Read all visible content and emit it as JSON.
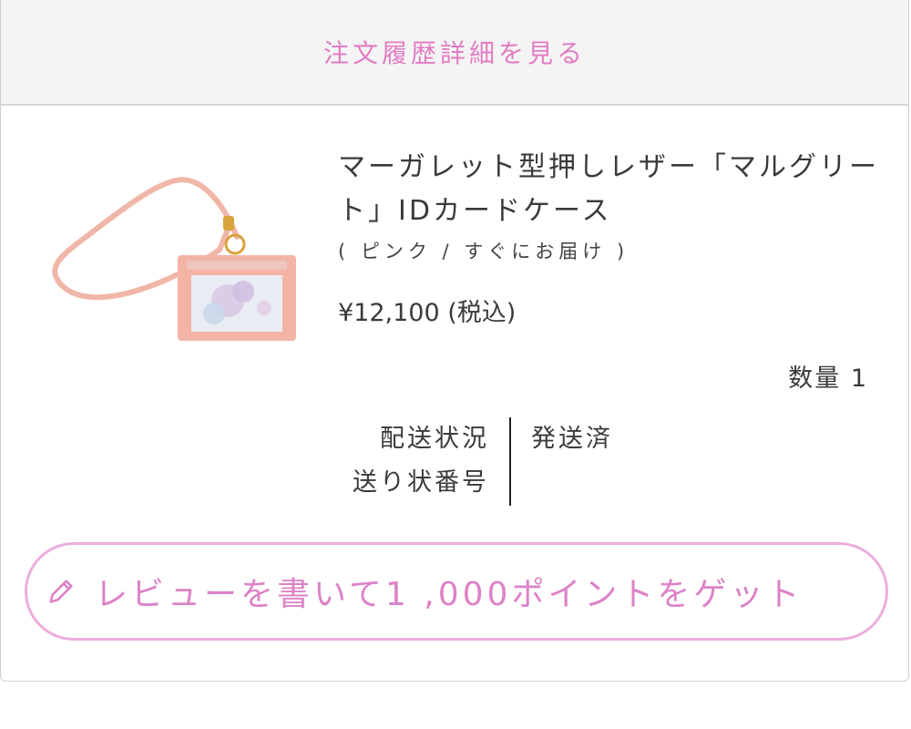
{
  "header": {
    "order_detail_link": "注文履歴詳細を見る"
  },
  "product": {
    "title": "マーガレット型押しレザー「マルグリート」IDカードケース",
    "variant": "( ピンク / すぐにお届け )",
    "price": "¥12,100 (税込)",
    "quantity": "数量 1",
    "image_icon": "id-card-case-image"
  },
  "shipping": {
    "status_label": "配送状況",
    "tracking_label": "送り状番号",
    "status_value": "発送済",
    "tracking_value": ""
  },
  "review": {
    "button_label": "レビューを書いて1 ,000ポイントをゲット",
    "icon": "pencil-icon"
  },
  "colors": {
    "accent_pink": "#e37cc4",
    "button_border": "#ecaedd",
    "product_pink": "#f0b6a8"
  }
}
